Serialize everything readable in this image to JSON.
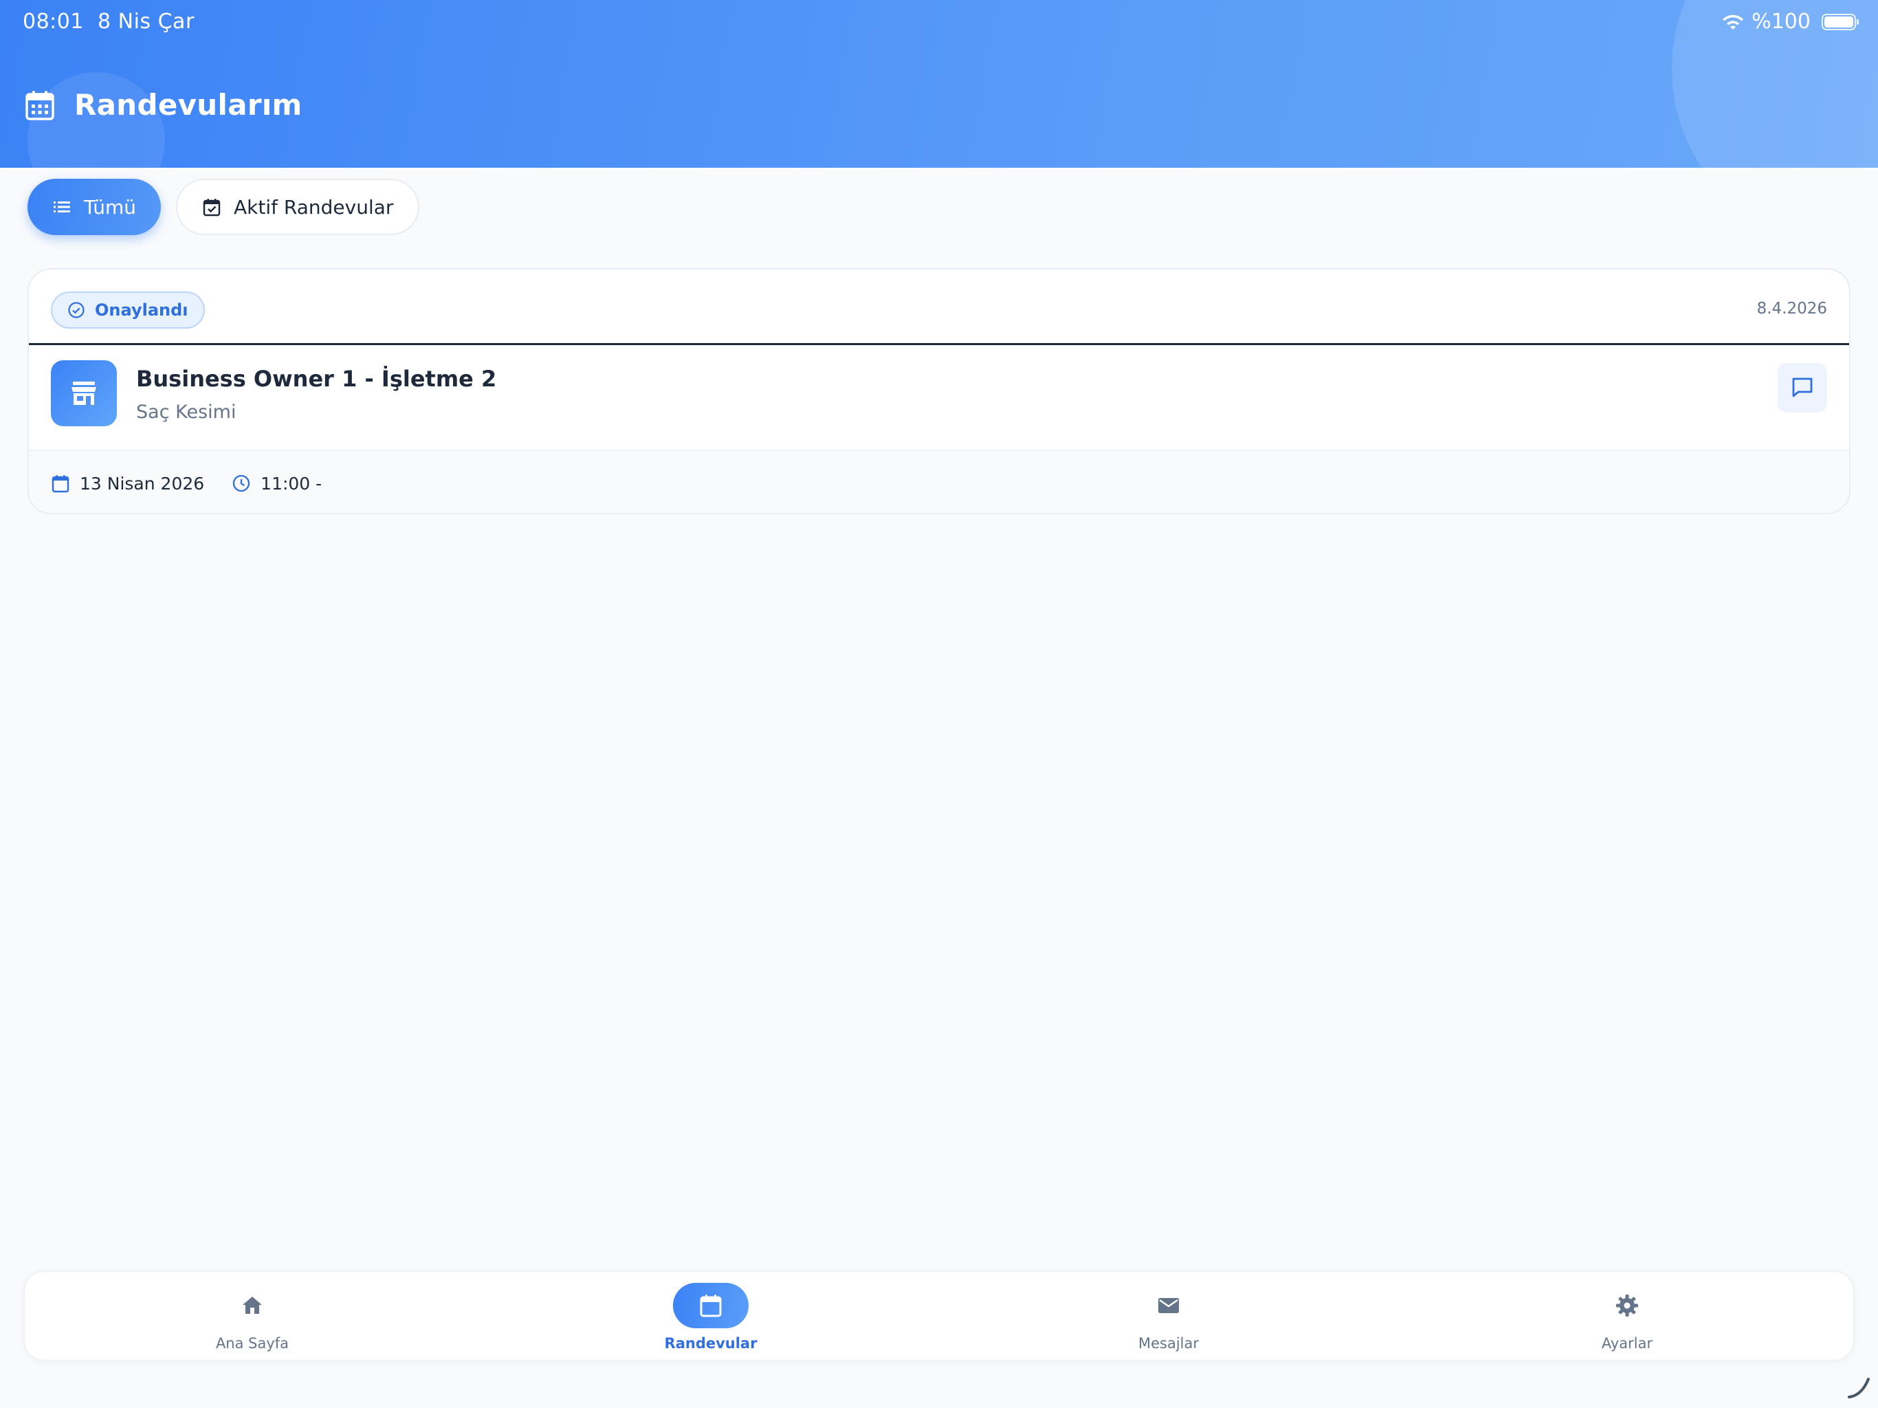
{
  "status_bar": {
    "time": "08:01",
    "date": "8 Nis Çar",
    "battery": "%100"
  },
  "header": {
    "title": "Randevularım",
    "icon": "calendar-icon"
  },
  "filters": [
    {
      "label": "Tümü",
      "icon": "list-icon",
      "active": true
    },
    {
      "label": "Aktif Randevular",
      "icon": "calendar-check-icon",
      "active": false
    }
  ],
  "appointment": {
    "status": "Onaylandı",
    "created_date": "8.4.2026",
    "business": "Business Owner 1 - İşletme 2",
    "service": "Saç Kesimi",
    "date": "13 Nisan 2026",
    "time": "11:00 -"
  },
  "nav": [
    {
      "label": "Ana Sayfa",
      "icon": "home-icon",
      "active": false
    },
    {
      "label": "Randevular",
      "icon": "calendar-icon",
      "active": true
    },
    {
      "label": "Mesajlar",
      "icon": "mail-icon",
      "active": false
    },
    {
      "label": "Ayarlar",
      "icon": "gear-icon",
      "active": false
    }
  ],
  "colors": {
    "primary": "#3b82f6",
    "primary_text": "#2f6fe0",
    "muted": "#64748b",
    "background": "#f8fafc"
  }
}
